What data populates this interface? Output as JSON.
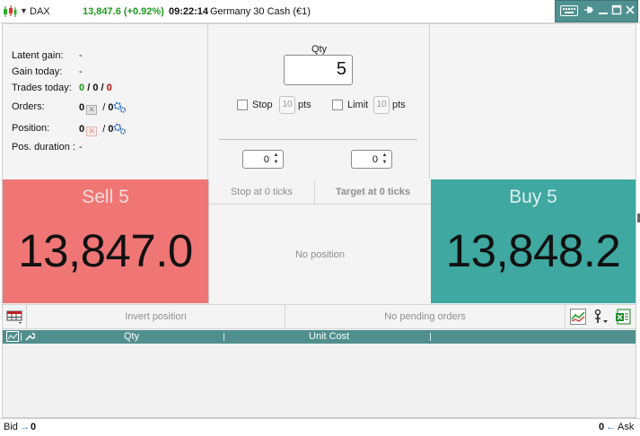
{
  "titlebar": {
    "symbol": "DAX",
    "price": "13,847.6 (+0.92%)",
    "time": "09:22:14",
    "instrument": "Germany 30 Cash (€1)",
    "colors": {
      "price": "#1f9a1f",
      "controls_bg": "#4f9191"
    },
    "icons": [
      "chart-candle-icon",
      "keyboard-icon",
      "pin-icon",
      "minimize-icon",
      "maximize-icon",
      "close-icon"
    ]
  },
  "info": {
    "latent_gain_label": "Latent gain:",
    "latent_gain_value": "-",
    "gain_today_label": "Gain today:",
    "gain_today_value": "-",
    "trades_today_label": "Trades today:",
    "trades_today_green": "0",
    "trades_today_black": "0",
    "trades_today_red": "0",
    "slash": "/",
    "orders_label": "Orders:",
    "orders_count": "0",
    "orders_count2": "0",
    "position_label": "Position:",
    "position_count": "0",
    "position_count2": "0",
    "pos_duration_label": "Pos. duration :",
    "pos_duration_value": "-"
  },
  "order": {
    "qty_label": "Qty",
    "qty_value": "5",
    "stop_label": "Stop",
    "stop_pts": "10",
    "limit_label": "Limit",
    "limit_pts": "10",
    "pts_label": "pts",
    "spinner_left": "0",
    "spinner_right": "0"
  },
  "sell": {
    "title": "Sell 5",
    "price": "13,847.0",
    "color": "#f07676"
  },
  "buy": {
    "title": "Buy 5",
    "price": "13,848.2",
    "color": "#3fa8a0"
  },
  "middle": {
    "stop_header": "Stop at 0 ticks",
    "target_header": "Target at 0 ticks",
    "no_position": "No position"
  },
  "actions": {
    "invert_position": "Invert position",
    "no_pending_orders": "No pending orders"
  },
  "table": {
    "columns": [
      "Qty",
      "Unit Cost"
    ]
  },
  "footer": {
    "bid_label": "Bid",
    "bid_value": "0",
    "ask_label": "Ask",
    "ask_value": "0"
  }
}
